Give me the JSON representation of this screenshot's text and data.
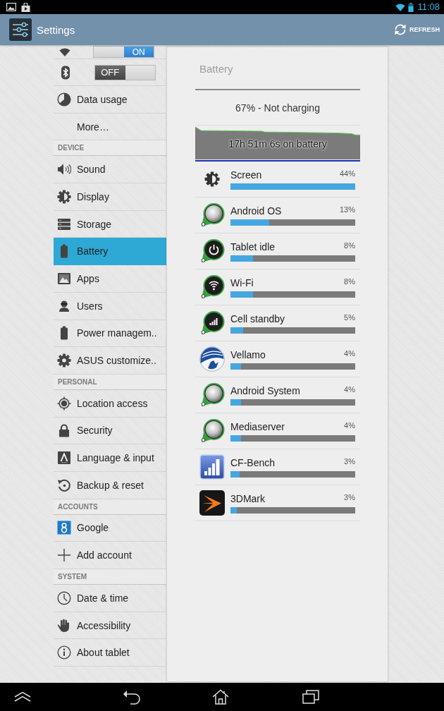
{
  "status_bar": {
    "time": "11:08"
  },
  "action_bar": {
    "title": "Settings",
    "action": "REFRESH"
  },
  "sidebar": {
    "sections": [
      {
        "items": [
          {
            "kind": "toggle",
            "switch_label": "ON",
            "on": true,
            "selected": false
          },
          {
            "kind": "toggle",
            "switch_label": "OFF",
            "on": false,
            "selected": false
          },
          {
            "kind": "link",
            "label": "Data usage",
            "selected": false
          },
          {
            "kind": "link",
            "label": "More…",
            "selected": false
          }
        ]
      },
      {
        "header": "DEVICE",
        "items": [
          {
            "kind": "link",
            "label": "Sound",
            "selected": false
          },
          {
            "kind": "link",
            "label": "Display",
            "selected": false
          },
          {
            "kind": "link",
            "label": "Storage",
            "selected": false
          },
          {
            "kind": "link",
            "label": "Battery",
            "selected": true
          },
          {
            "kind": "link",
            "label": "Apps",
            "selected": false
          },
          {
            "kind": "link",
            "label": "Users",
            "selected": false
          },
          {
            "kind": "link",
            "label": "Power managem..",
            "selected": false
          },
          {
            "kind": "link",
            "label": "ASUS customize..",
            "selected": false
          }
        ]
      },
      {
        "header": "PERSONAL",
        "items": [
          {
            "kind": "link",
            "label": "Location access",
            "selected": false
          },
          {
            "kind": "link",
            "label": "Security",
            "selected": false
          },
          {
            "kind": "link",
            "label": "Language & input",
            "selected": false
          },
          {
            "kind": "link",
            "label": "Backup & reset",
            "selected": false
          }
        ]
      },
      {
        "header": "ACCOUNTS",
        "items": [
          {
            "kind": "link",
            "label": "Google",
            "selected": false
          },
          {
            "kind": "link",
            "label": "Add account",
            "selected": false
          }
        ]
      },
      {
        "header": "SYSTEM",
        "items": [
          {
            "kind": "link",
            "label": "Date & time",
            "selected": false
          },
          {
            "kind": "link",
            "label": "Accessibility",
            "selected": false
          },
          {
            "kind": "link",
            "label": "About tablet",
            "selected": false
          }
        ]
      }
    ]
  },
  "battery_panel": {
    "title": "Battery",
    "status": "67% - Not charging",
    "history_label": "17h 51m 6s on battery",
    "usage": [
      {
        "name": "Screen",
        "percent": "44%",
        "level": 1.0
      },
      {
        "name": "Android OS",
        "percent": "13%",
        "level": 0.31
      },
      {
        "name": "Tablet idle",
        "percent": "8%",
        "level": 0.18
      },
      {
        "name": "Wi-Fi",
        "percent": "8%",
        "level": 0.18
      },
      {
        "name": "Cell standby",
        "percent": "5%",
        "level": 0.1
      },
      {
        "name": "Vellamo",
        "percent": "4%",
        "level": 0.085
      },
      {
        "name": "Android System",
        "percent": "4%",
        "level": 0.085
      },
      {
        "name": "Mediaserver",
        "percent": "4%",
        "level": 0.085
      },
      {
        "name": "CF-Bench",
        "percent": "3%",
        "level": 0.073
      },
      {
        "name": "3DMark",
        "percent": "3%",
        "level": 0.05
      }
    ]
  }
}
